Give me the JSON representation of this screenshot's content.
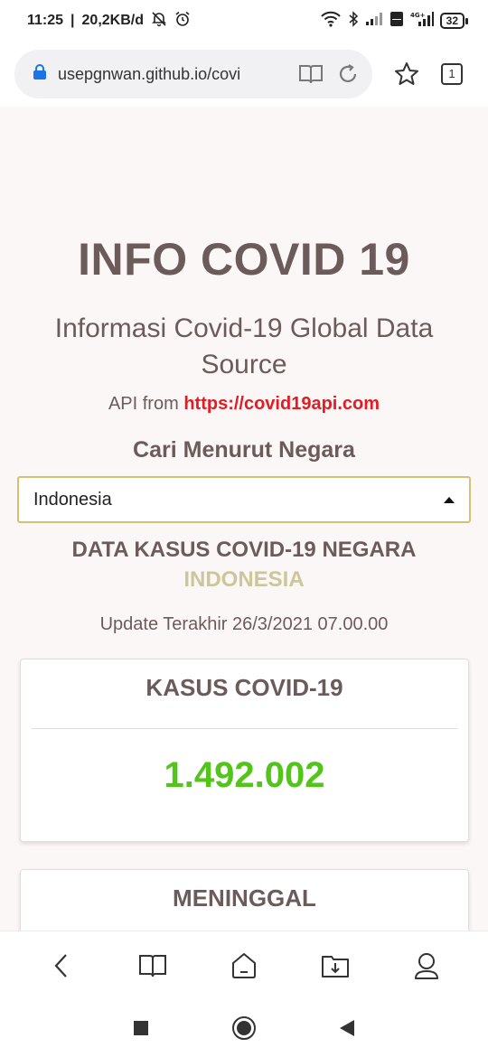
{
  "status_bar": {
    "time": "11:25",
    "speed": "20,2KB/d",
    "battery": "32",
    "icons": [
      "alarm-off-icon",
      "alarm-icon",
      "wifi-icon",
      "bluetooth-icon",
      "signal-icon",
      "volte-icon",
      "4g-signal-icon",
      "battery-icon"
    ]
  },
  "browser": {
    "url": "usepgnwan.github.io/covi",
    "tab_count": "1",
    "icons": [
      "lock-icon",
      "reader-mode-icon",
      "reload-icon",
      "bookmark-star-icon",
      "tabs-icon"
    ]
  },
  "page": {
    "title": "INFO COVID 19",
    "subtitle": "Informasi Covid-19 Global Data Source",
    "api_prefix": "API from",
    "api_link": "https://covid19api.com",
    "search_label": "Cari Menurut Negara",
    "selected_country": "Indonesia",
    "data_heading": "DATA KASUS COVID-19 NEGARA",
    "country_name": "INDONESIA",
    "update_label": "Update Terakhir 26/3/2021 07.00.00",
    "cards": [
      {
        "title": "KASUS COVID-19",
        "value": "1.492.002"
      },
      {
        "title": "MENINGGAL",
        "value": ""
      }
    ]
  },
  "colors": {
    "text": "#6b5b5b",
    "link": "#e11c24",
    "country": "#cbc79a",
    "cases_value": "#52c41a",
    "select_border": "#d9bf73",
    "background": "#fcf7f7"
  },
  "bottom_nav": {
    "icons": [
      "back-icon",
      "bookmarks-icon",
      "home-icon",
      "downloads-icon",
      "profile-icon"
    ]
  },
  "system_nav": {
    "icons": [
      "recents-icon",
      "home-circle-icon",
      "back-triangle-icon"
    ]
  }
}
